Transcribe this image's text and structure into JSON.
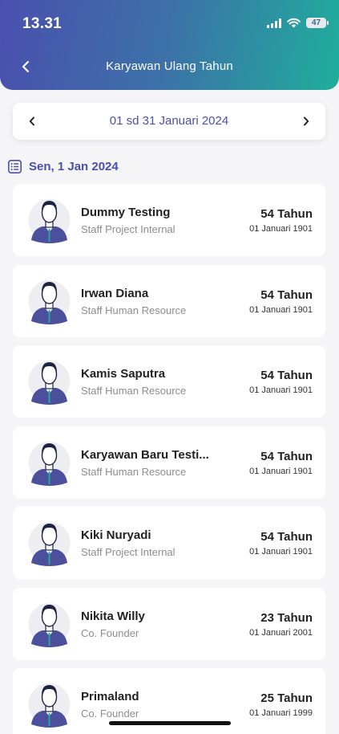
{
  "status_bar": {
    "time": "13.31",
    "battery": "47"
  },
  "header": {
    "title": "Karyawan Ulang Tahun"
  },
  "date_range": {
    "label": "01 sd 31 Januari 2024"
  },
  "section": {
    "date_label": "Sen, 1 Jan 2024"
  },
  "employees": [
    {
      "name": "Dummy Testing",
      "role": "Staff Project Internal",
      "age": "54 Tahun",
      "birth_date": "01 Januari 1901"
    },
    {
      "name": "Irwan Diana",
      "role": "Staff Human Resource",
      "age": "54 Tahun",
      "birth_date": "01 Januari 1901"
    },
    {
      "name": "Kamis Saputra",
      "role": "Staff Human Resource",
      "age": "54 Tahun",
      "birth_date": "01 Januari 1901"
    },
    {
      "name": "Karyawan Baru Testi...",
      "role": "Staff Human Resource",
      "age": "54 Tahun",
      "birth_date": "01 Januari 1901"
    },
    {
      "name": "Kiki Nuryadi",
      "role": "Staff Project Internal",
      "age": "54 Tahun",
      "birth_date": "01 Januari 1901"
    },
    {
      "name": "Nikita Willy",
      "role": "Co. Founder",
      "age": "23 Tahun",
      "birth_date": "01 Januari 2001"
    },
    {
      "name": "Primaland",
      "role": "Co. Founder",
      "age": "25 Tahun",
      "birth_date": "01 Januari 1999"
    }
  ],
  "colors": {
    "accent": "#4a4fae",
    "gradient_end": "#1fae9c"
  }
}
